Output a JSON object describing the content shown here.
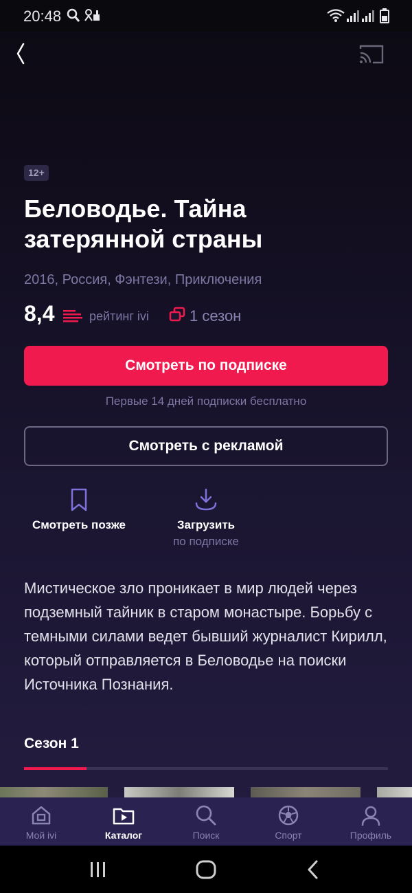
{
  "status_bar": {
    "time": "20:48"
  },
  "header": {
    "back_icon": "chevron-left-icon",
    "cast_icon": "cast-icon"
  },
  "content": {
    "age_rating": "12+",
    "title": "Беловодье. Тайна затерянной страны",
    "meta": "2016, Россия, Фэнтези, Приключения",
    "rating_value": "8,4",
    "rating_label": "рейтинг ivi",
    "seasons_label": "1 сезон",
    "watch_subscription_label": "Смотреть по подписке",
    "trial_note": "Первые 14 дней подписки бесплатно",
    "watch_ads_label": "Смотреть с рекламой",
    "watch_later_label": "Смотреть позже",
    "download_label": "Загрузить",
    "download_sub": "по подписке",
    "description": "Мистическое зло проникает в мир людей через подземный тайник в старом монастыре. Борьбу с темными силами ведет бывший журналист Кирилл, который отправляется в Беловодье на поиски Источника Познания.",
    "season_tab": "Сезон 1"
  },
  "bottom_nav": {
    "items": [
      {
        "label": "Мой ivi",
        "icon": "home-icon"
      },
      {
        "label": "Каталог",
        "icon": "catalog-icon"
      },
      {
        "label": "Поиск",
        "icon": "search-icon"
      },
      {
        "label": "Спорт",
        "icon": "ball-icon"
      },
      {
        "label": "Профиль",
        "icon": "profile-icon"
      }
    ],
    "active_index": 1
  },
  "colors": {
    "accent": "#f01a4f",
    "muted_text": "#7d77a3",
    "nav_bg": "#2a2250"
  }
}
